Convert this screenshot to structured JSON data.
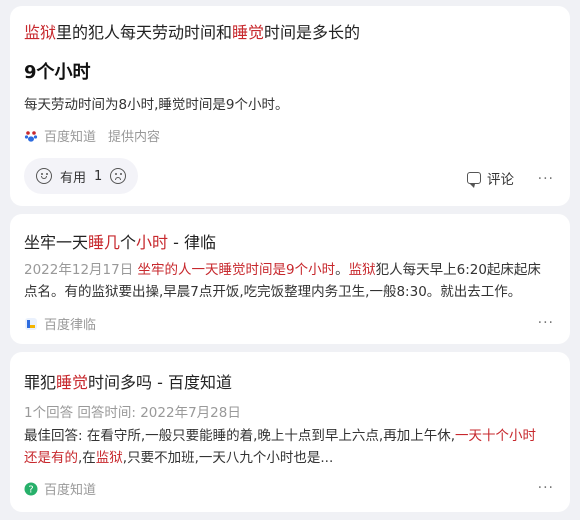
{
  "card1": {
    "title_parts": [
      {
        "text": "监狱",
        "hl": true
      },
      {
        "text": "里的犯人每天劳动时间和",
        "hl": false
      },
      {
        "text": "睡觉",
        "hl": true
      },
      {
        "text": "时间是多长的",
        "hl": false
      }
    ],
    "answer": "9个小时",
    "description": "每天劳动时间为8小时,睡觉时间是9个小时。",
    "source": "百度知道",
    "source_extra": "提供内容",
    "useful_label": "有用",
    "useful_count": "1",
    "comment_label": "评论",
    "more": "···"
  },
  "card2": {
    "title_parts": [
      {
        "text": "坐牢一天",
        "hl": false
      },
      {
        "text": "睡几",
        "hl": true
      },
      {
        "text": "个",
        "hl": false
      },
      {
        "text": "小时",
        "hl": true
      },
      {
        "text": " - 律临",
        "hl": false
      }
    ],
    "desc_parts": [
      {
        "text": "2022年12月17日  ",
        "cls": "meta"
      },
      {
        "text": "坐牢的人一天睡觉时间是9个小时",
        "cls": "hl"
      },
      {
        "text": "。",
        "cls": ""
      },
      {
        "text": "监狱",
        "cls": "hl"
      },
      {
        "text": "犯人每天早上6:20起床起床点名。有的监狱要出操,早晨7点开饭,吃完饭整理内务卫生,一般8:30。就出去工作。",
        "cls": ""
      }
    ],
    "source": "百度律临",
    "more": "···"
  },
  "card3": {
    "title_parts": [
      {
        "text": "罪犯",
        "hl": false
      },
      {
        "text": "睡觉",
        "hl": true
      },
      {
        "text": "时间多吗 - 百度知道",
        "hl": false
      }
    ],
    "meta": "1个回答   回答时间:  2022年7月28日",
    "desc_parts": [
      {
        "text": "最佳回答:  在看守所,一般只要能睡的着,晚上十点到早上六点,再加上午休,",
        "cls": ""
      },
      {
        "text": "一天十个小时还是有的",
        "cls": "hl"
      },
      {
        "text": ",在",
        "cls": ""
      },
      {
        "text": "监狱",
        "cls": "hl"
      },
      {
        "text": ",只要不加班,一天八九个小时也是...",
        "cls": ""
      }
    ],
    "source": "百度知道",
    "more": "···"
  },
  "colors": {
    "highlight": "#c7282d",
    "card_bg": "#ffffff",
    "page_bg": "#f0f1f5"
  }
}
